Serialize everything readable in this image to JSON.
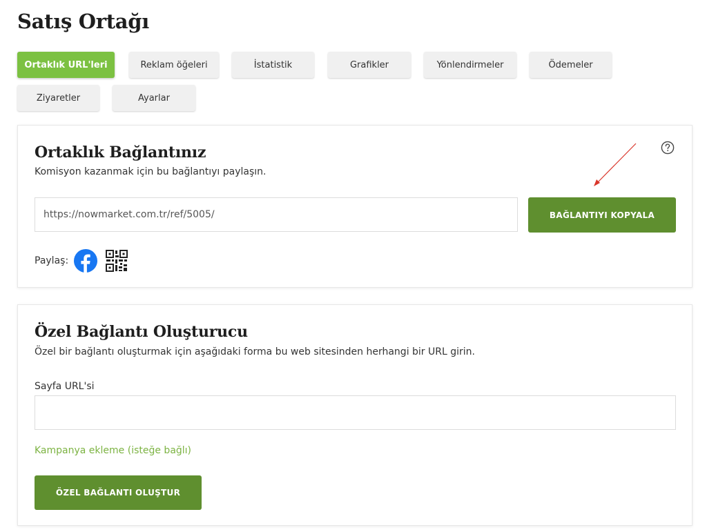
{
  "page": {
    "title": "Satış Ortağı"
  },
  "tabs": [
    {
      "label": "Ortaklık URL'leri",
      "active": true
    },
    {
      "label": "Reklam öğeleri",
      "active": false
    },
    {
      "label": "İstatistik",
      "active": false
    },
    {
      "label": "Grafikler",
      "active": false
    },
    {
      "label": "Yönlendirmeler",
      "active": false
    },
    {
      "label": "Ödemeler",
      "active": false
    },
    {
      "label": "Ziyaretler",
      "active": false
    },
    {
      "label": "Ayarlar",
      "active": false
    }
  ],
  "affiliate_link": {
    "title": "Ortaklık Bağlantınız",
    "description": "Komisyon kazanmak için bu bağlantıyı paylaşın.",
    "url": "https://nowmarket.com.tr/ref/5005/",
    "copy_button": "BAĞLANTIYI KOPYALA",
    "help_icon": "question-circle-icon",
    "share_label": "Paylaş:",
    "share_icons": [
      "facebook-icon",
      "qr-code-icon"
    ]
  },
  "custom_link": {
    "title": "Özel Bağlantı Oluşturucu",
    "description": "Özel bir bağlantı oluşturmak için aşağıdaki forma bu web sitesinden herhangi bir URL girin.",
    "field_label": "Sayfa URL'si",
    "field_value": "",
    "campaign_link": "Kampanya ekleme (isteğe bağlı)",
    "create_button": "ÖZEL BAĞLANTI OLUŞTUR"
  },
  "colors": {
    "active_tab": "#7cc142",
    "button": "#5f8f2f",
    "link": "#7cb342",
    "facebook": "#1877f2",
    "annotation_arrow": "#d9362b"
  }
}
